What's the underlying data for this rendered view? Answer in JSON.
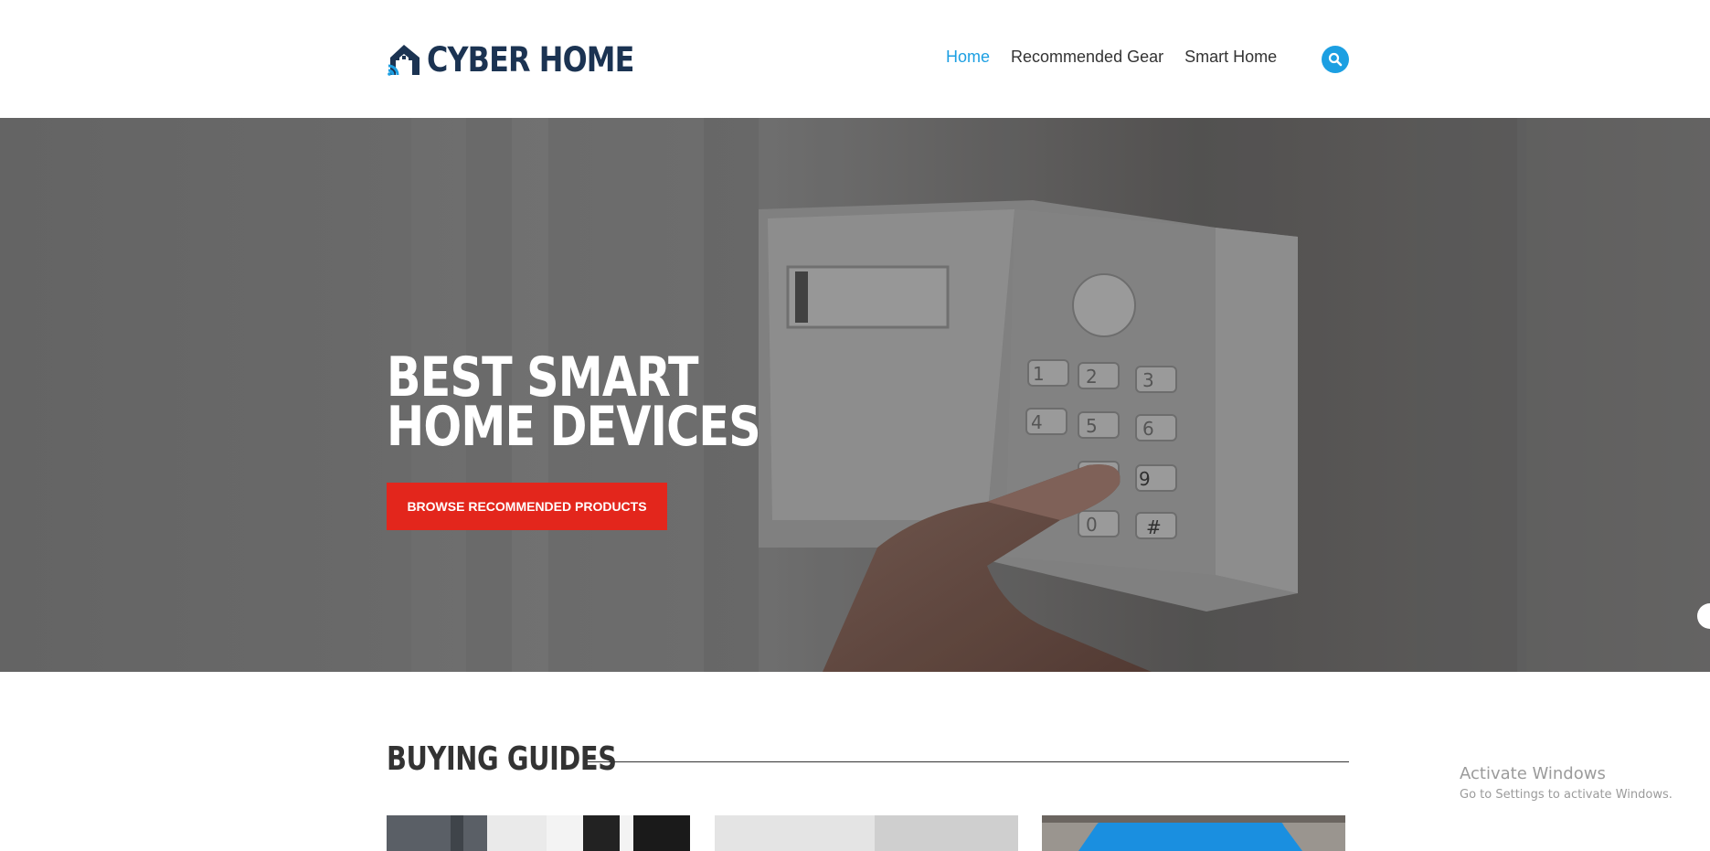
{
  "header": {
    "logo_text": "CYBER HOME",
    "nav": [
      {
        "label": "Home",
        "active": true
      },
      {
        "label": "Recommended Gear",
        "active": false
      },
      {
        "label": "Smart Home",
        "active": false
      }
    ],
    "search_icon": "search-icon"
  },
  "hero": {
    "title_line1": "BEST SMART",
    "title_line2": "HOME DEVICES",
    "cta_label": "BROWSE RECOMMENDED PRODUCTS",
    "background_image": "keypad-alarm-photo"
  },
  "guides": {
    "title": "BUYING GUIDES",
    "cards": [
      {
        "image": "guide-thumbnail-1"
      },
      {
        "image": "guide-thumbnail-2"
      },
      {
        "image": "guide-thumbnail-3"
      }
    ]
  },
  "watermark": {
    "title": "Activate Windows",
    "subtitle": "Go to Settings to activate Windows."
  },
  "colors": {
    "accent_blue": "#1c9fe2",
    "brand_navy": "#1b3352",
    "cta_red": "#e3261c"
  }
}
